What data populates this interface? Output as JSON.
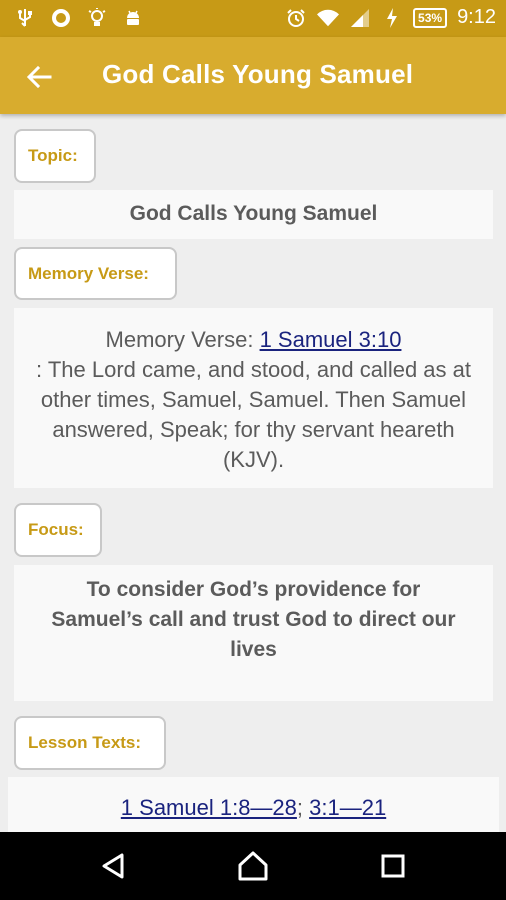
{
  "status_bar": {
    "battery": "53%",
    "time": "9:12",
    "icons_left": [
      "usb-icon",
      "ring-icon",
      "lightbulb-icon",
      "android-icon"
    ],
    "icons_right": [
      "alarm-icon",
      "wifi-icon",
      "signal-icon",
      "charging-icon"
    ]
  },
  "app_bar": {
    "title": "God Calls Young Samuel",
    "back_icon": "arrow-left-icon"
  },
  "sections": {
    "topic": {
      "label": "Topic:",
      "text": "God Calls Young Samuel"
    },
    "memory_verse": {
      "label": "Memory Verse:",
      "prefix": "Memory Verse: ",
      "reference": "1 Samuel 3:10",
      "text": ": The Lord came, and stood, and called as at other times, Samuel, Samuel. Then Samuel answered, Speak; for thy servant heareth (KJV)."
    },
    "focus": {
      "label": "Focus:",
      "text": "To consider God’s providence for Samuel’s call and trust God to direct our lives"
    },
    "lesson_texts": {
      "label": "Lesson Texts:",
      "ref1": "1 Samuel 1:8—28",
      "separator": "; ",
      "ref2": "3:1—21"
    }
  },
  "nav_bar": {
    "back_icon": "nav-back-icon",
    "home_icon": "nav-home-icon",
    "recents_icon": "nav-recents-icon"
  },
  "colors": {
    "status_bar": "#c79a16",
    "app_bar": "#d8ac2e",
    "label_text": "#c79a16",
    "link": "#1a237e"
  }
}
